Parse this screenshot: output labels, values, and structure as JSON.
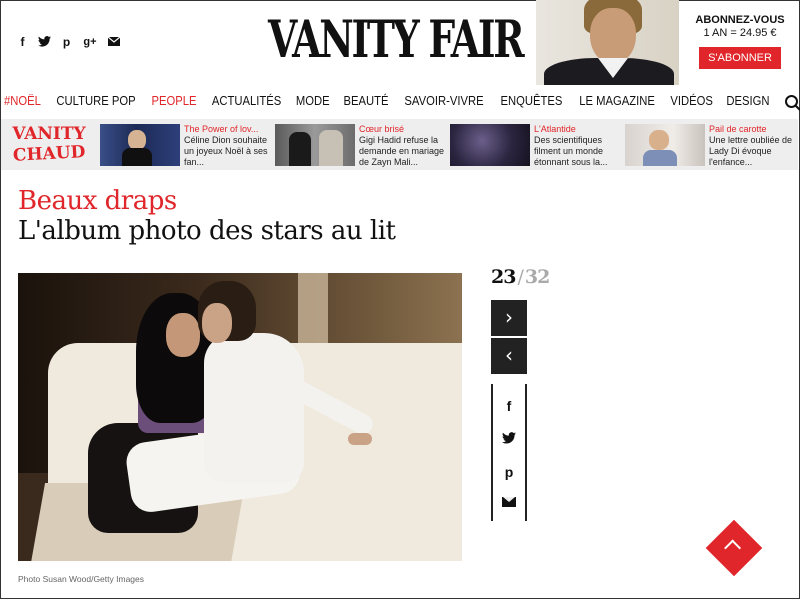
{
  "header": {
    "logo": "VANITY FAIR",
    "social_icons": [
      "facebook-icon",
      "twitter-icon",
      "pinterest-icon",
      "googleplus-icon",
      "mail-icon"
    ],
    "subscribe": {
      "title": "ABONNEZ-VOUS",
      "price": "1 AN = 24.95 €",
      "button": "S'ABONNER"
    }
  },
  "nav": {
    "items": [
      {
        "label": "#NOËL",
        "red": true
      },
      {
        "label": "CULTURE POP",
        "red": false
      },
      {
        "label": "PEOPLE",
        "red": true
      },
      {
        "label": "ACTUALITÉS",
        "red": false
      },
      {
        "label": "MODE",
        "red": false
      },
      {
        "label": "BEAUTÉ",
        "red": false
      },
      {
        "label": "SAVOIR-VIVRE",
        "red": false
      },
      {
        "label": "ENQUÊTES",
        "red": false
      },
      {
        "label": "LE MAGAZINE",
        "red": false
      },
      {
        "label": "VIDÉOS",
        "red": false
      },
      {
        "label": "DESIGN",
        "red": false
      }
    ]
  },
  "hot": {
    "brand_line1": "VANITY",
    "brand_line2": "CHAUD",
    "items": [
      {
        "kicker": "The Power of lov...",
        "text": "Céline Dion souhaite un joyeux Noël à ses fan..."
      },
      {
        "kicker": "Cœur brisé",
        "text": "Gigi Hadid refuse la demande en mariage de Zayn Mali..."
      },
      {
        "kicker": "L'Atlantide",
        "text": "Des scientifiques filment un monde étonnant sous la..."
      },
      {
        "kicker": "Pail de carotte",
        "text": "Une lettre oubliée de Lady Di évoque l'enfance..."
      }
    ]
  },
  "article": {
    "kicker": "Beaux draps",
    "title": "L'album photo des stars au lit",
    "credit": "Photo Susan Wood/Getty Images"
  },
  "gallery": {
    "current": "23",
    "separator": "/",
    "total": "32",
    "next_symbol": "›",
    "prev_symbol": "‹"
  },
  "share": {
    "facebook": "f",
    "pinterest": "p"
  },
  "colors": {
    "accent": "#e0262a",
    "dark": "#222222",
    "strip": "#eeeeee"
  }
}
